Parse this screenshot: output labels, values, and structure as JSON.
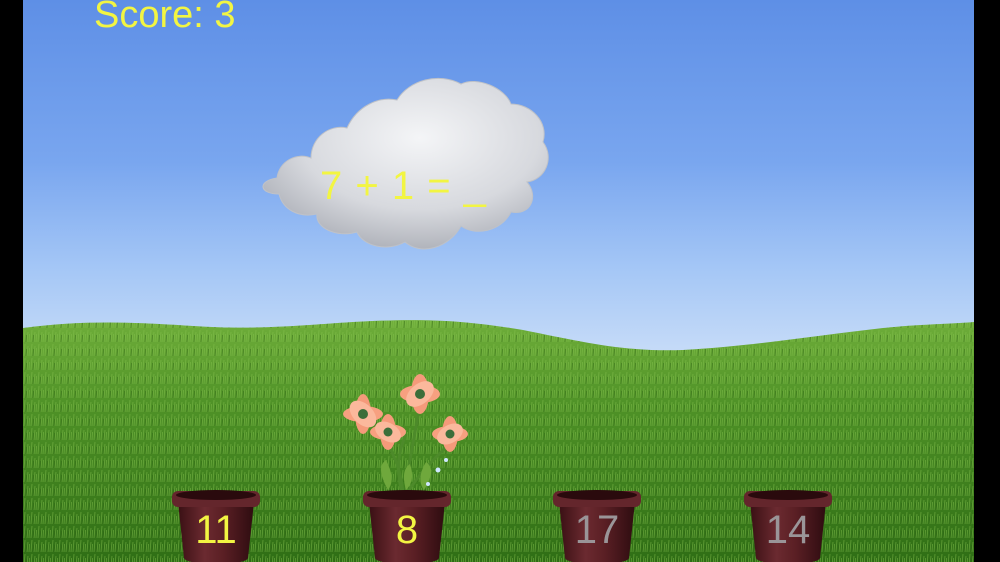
{
  "hud": {
    "score_text": "Score: 3"
  },
  "question": {
    "equation_text": "7 + 1 = _"
  },
  "pots": [
    {
      "value": "11",
      "color": "#f2f542",
      "state": "available"
    },
    {
      "value": "8",
      "color": "#f2f542",
      "state": "correct-bloomed"
    },
    {
      "value": "17",
      "color": "#9a9598",
      "state": "dimmed"
    },
    {
      "value": "14",
      "color": "#9a9598",
      "state": "dimmed"
    }
  ],
  "icons": {
    "cloud": "cloud-icon",
    "flower": "flower-icon",
    "pot": "flower-pot-icon"
  },
  "colors": {
    "text_accent": "#f2f542",
    "pot_body": "#5a1f24"
  }
}
